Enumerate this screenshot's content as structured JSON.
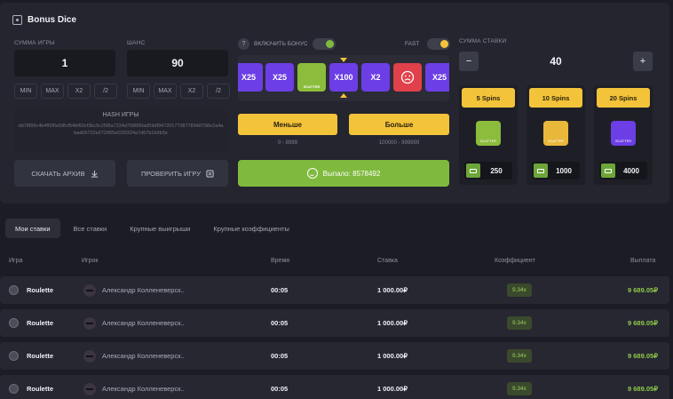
{
  "header": {
    "title": "Bonus Dice"
  },
  "left": {
    "bet_label": "СУММА ИГРЫ",
    "bet_value": "1",
    "chance_label": "ШАНС",
    "chance_value": "90",
    "bet_buttons": [
      "MIN",
      "MAX",
      "X2",
      "/2"
    ],
    "chance_buttons": [
      "MIN",
      "MAX",
      "X2",
      "/2"
    ],
    "hash_label": "HASH ИГРЫ",
    "hash_value": "dd78f99c4b4ff2f0e58fcf54bf60cf3bc9c25f8a7234d758890ad59df9472017708778948798e2a4abad06722e272065ef230324a7d67b1b9b3e",
    "download_label": "СКАЧАТЬ АРХИВ",
    "verify_label": "ПРОВЕРИТЬ ИГРУ"
  },
  "middle": {
    "bonus_toggle_label": "ВКЛЮЧИТЬ БОНУС",
    "bonus_help": "?",
    "fast_label": "FAST",
    "tiles": [
      {
        "label": "X25",
        "kind": "purple"
      },
      {
        "label": "X25",
        "kind": "purple"
      },
      {
        "label": "SCATTER",
        "kind": "green"
      },
      {
        "label": "X100",
        "kind": "purple"
      },
      {
        "label": "X2",
        "kind": "purple"
      },
      {
        "label": "",
        "kind": "red"
      },
      {
        "label": "X25",
        "kind": "purple"
      }
    ],
    "less_label": "Меньше",
    "less_range": "0 - 8999",
    "more_label": "Больше",
    "more_range": "100000 - 999999",
    "result_label": "Выпало: 8578492"
  },
  "right": {
    "stake_label": "СУММА СТАВКИ",
    "stake_value": "40",
    "minus": "−",
    "plus": "+",
    "cards": [
      {
        "title": "5 Spins",
        "icon_label": "SCATTER",
        "icon_color": "#8cbc3c",
        "value": "250"
      },
      {
        "title": "10 Spins",
        "icon_label": "SCATTER",
        "icon_color": "#e9b73a",
        "value": "1000"
      },
      {
        "title": "20 Spins",
        "icon_label": "SCATTER",
        "icon_color": "#6c3ee6",
        "value": "4000"
      }
    ]
  },
  "tabs": [
    "Мои ставки",
    "Все ставки",
    "Крупные выигрыши",
    "Крупные коэффициенты"
  ],
  "table": {
    "headers": [
      "Игра",
      "Игрок",
      "Время",
      "Ставка",
      "Коэффициент",
      "Выплата"
    ],
    "rows": [
      {
        "game": "Roulette",
        "player": "Александр Колленеверск..",
        "time": "00:05",
        "bet": "1 000.00₽",
        "coef": "9.34x",
        "payout": "9 689.05₽"
      },
      {
        "game": "Roulette",
        "player": "Александр Колленеверск..",
        "time": "00:05",
        "bet": "1 000.00₽",
        "coef": "9.34x",
        "payout": "9 689.05₽"
      },
      {
        "game": "Roulette",
        "player": "Александр Колленеверск..",
        "time": "00:05",
        "bet": "1 000.00₽",
        "coef": "9.34x",
        "payout": "9 689.05₽"
      },
      {
        "game": "Roulette",
        "player": "Александр Колленеверск..",
        "time": "00:05",
        "bet": "1 000.00₽",
        "coef": "9.34x",
        "payout": "9 689.05₽"
      }
    ]
  },
  "colors": {
    "accent_yellow": "#f3c33a",
    "accent_green": "#7fba3f",
    "accent_purple": "#6c3ee6",
    "danger_red": "#e0414a"
  }
}
